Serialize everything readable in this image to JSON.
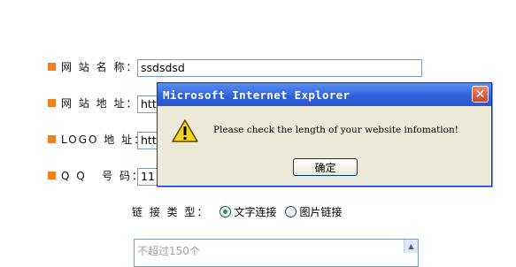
{
  "colors": {
    "bullet": "#f07f1f",
    "title_bar": "#2d5fd8",
    "dialog_bg": "#ece9d8",
    "radio_dot": "#21a121"
  },
  "form": {
    "rows": [
      {
        "label": "网 站 名 称：",
        "value": "ssdsdsd"
      },
      {
        "label": "网 站 地 址：",
        "value": "htt"
      },
      {
        "label": "LOGO 地 址：",
        "value": "htt"
      },
      {
        "label": "Q Q   号 码：",
        "value": "11"
      }
    ],
    "link_type": {
      "label": "链 接 类 型：",
      "options": [
        "文字连接",
        "图片链接"
      ],
      "selected": "文字连接"
    },
    "textarea": {
      "placeholder": "不超过150个"
    }
  },
  "dialog": {
    "title": "Microsoft Internet Explorer",
    "message": "Please check the length of your website infomation!",
    "ok_label": "确定",
    "icon": "warning-icon"
  }
}
